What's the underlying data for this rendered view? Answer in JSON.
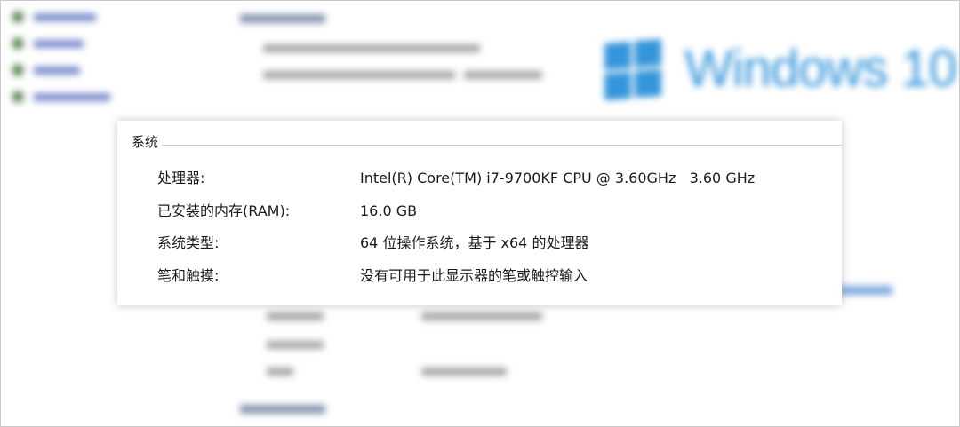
{
  "background": {
    "logo_text": "Windows 10",
    "accent_color": "#1e8ad6",
    "sidebar_icon_color": "#4e7d46",
    "link_color": "#6d7fc6"
  },
  "system_section": {
    "title": "系统",
    "rows": [
      {
        "label": "处理器:",
        "value": "Intel(R) Core(TM) i7-9700KF CPU @ 3.60GHz   3.60 GHz"
      },
      {
        "label": "已安装的内存(RAM):",
        "value": "16.0 GB"
      },
      {
        "label": "系统类型:",
        "value": "64 位操作系统，基于 x64 的处理器"
      },
      {
        "label": "笔和触摸:",
        "value": "没有可用于此显示器的笔或触控输入"
      }
    ]
  }
}
